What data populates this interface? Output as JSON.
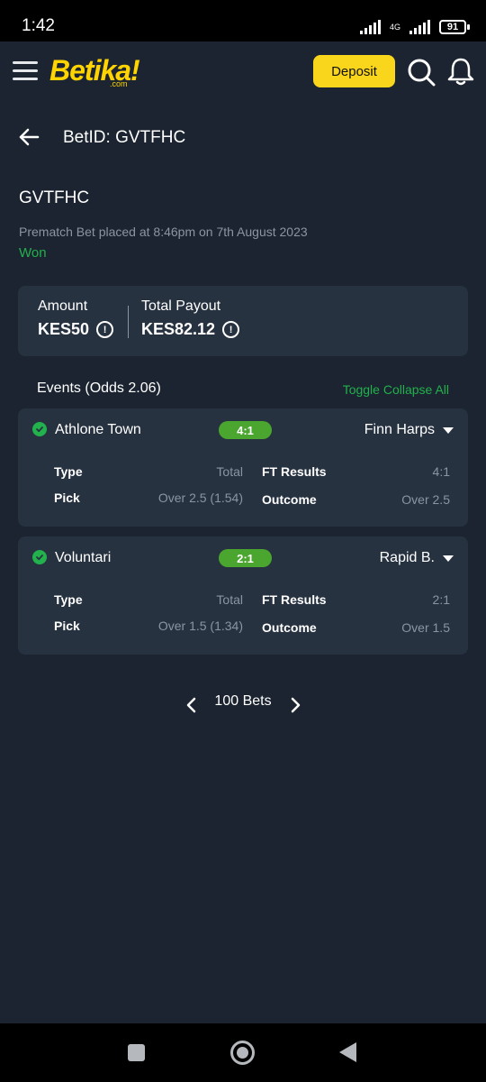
{
  "status_bar": {
    "time": "1:42",
    "network": "4G",
    "battery": "91"
  },
  "header": {
    "logo": "Betika!",
    "logo_sub": ".com",
    "deposit_label": "Deposit"
  },
  "page": {
    "title": "BetID: GVTFHC"
  },
  "bet": {
    "code": "GVTFHC",
    "meta": "Prematch Bet placed at 8:46pm on 7th August 2023",
    "status": "Won"
  },
  "summary": {
    "amount_label": "Amount",
    "amount_value": "KES50",
    "payout_label": "Total Payout",
    "payout_value": "KES82.12",
    "info_glyph": "!"
  },
  "events_section": {
    "heading": "Events (Odds 2.06)",
    "toggle_label": "Toggle Collapse All"
  },
  "events": [
    {
      "home": "Athlone Town",
      "score": "4:1",
      "away": "Finn Harps",
      "type_label": "Type",
      "type_value": "Total",
      "pick_label": "Pick",
      "pick_value": "Over 2.5 (1.54)",
      "ft_label": "FT Results",
      "ft_value": "4:1",
      "outcome_label": "Outcome",
      "outcome_value": "Over 2.5"
    },
    {
      "home": "Voluntari",
      "score": "2:1",
      "away": "Rapid B.",
      "type_label": "Type",
      "type_value": "Total",
      "pick_label": "Pick",
      "pick_value": "Over 1.5 (1.34)",
      "ft_label": "FT Results",
      "ft_value": "2:1",
      "outcome_label": "Outcome",
      "outcome_value": "Over 1.5"
    }
  ],
  "pager": {
    "label": "100 Bets"
  },
  "colors": {
    "accent_yellow": "#f9d51c",
    "success_green": "#22b14c",
    "score_green": "#4aa62f",
    "card_bg": "#273241",
    "page_bg": "#1b2430"
  },
  "icons": [
    "hamburger-icon",
    "search-icon",
    "bell-icon",
    "back-arrow-icon",
    "info-icon",
    "check-circle-icon",
    "caret-down-icon",
    "chevron-left-icon",
    "chevron-right-icon"
  ]
}
